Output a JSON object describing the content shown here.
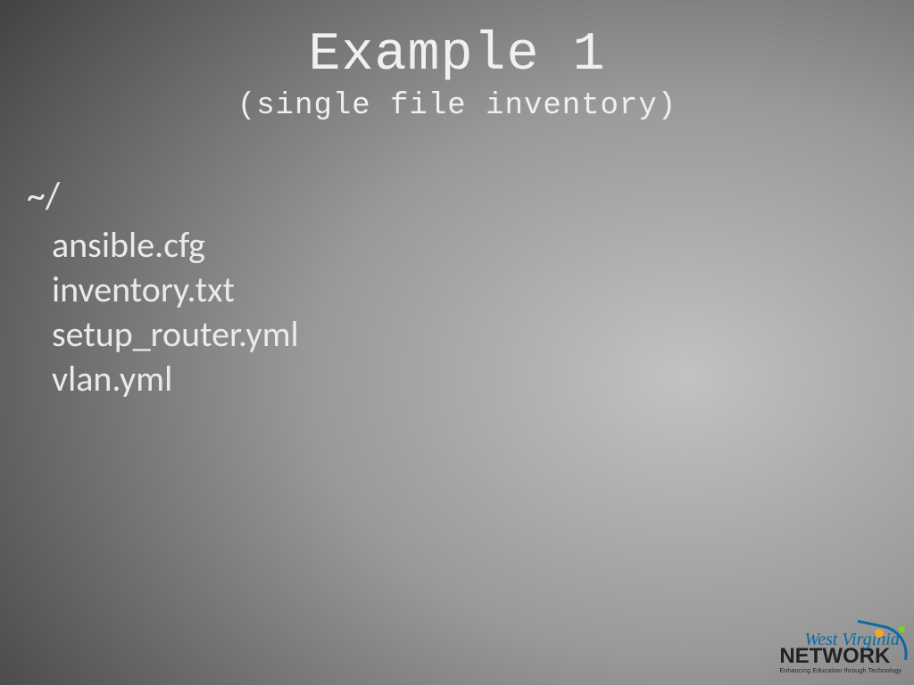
{
  "header": {
    "title": "Example 1",
    "subtitle": "(single file inventory)"
  },
  "content": {
    "root": "~/",
    "files": [
      "ansible.cfg",
      "inventory.txt",
      "setup_router.yml",
      "vlan.yml"
    ]
  },
  "logo": {
    "line1": "West Virginia",
    "line2": "NETWORK",
    "line3": "Enhancing Education through Technology"
  }
}
